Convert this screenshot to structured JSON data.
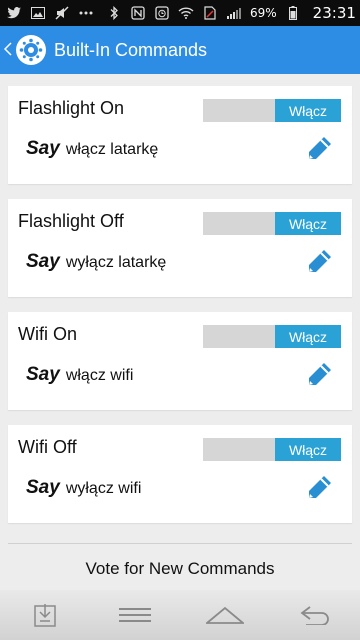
{
  "status_bar": {
    "battery": "69%",
    "clock": "23:31"
  },
  "app_bar": {
    "title": "Built-In Commands"
  },
  "commands": [
    {
      "title": "Flashlight On",
      "toggle_label": "Włącz",
      "say_word": "Say",
      "phrase": "włącz latarkę"
    },
    {
      "title": "Flashlight Off",
      "toggle_label": "Włącz",
      "say_word": "Say",
      "phrase": "wyłącz latarkę"
    },
    {
      "title": "Wifi On",
      "toggle_label": "Włącz",
      "say_word": "Say",
      "phrase": "włącz wifi"
    },
    {
      "title": "Wifi Off",
      "toggle_label": "Włącz",
      "say_word": "Say",
      "phrase": "wyłącz wifi"
    }
  ],
  "footer": {
    "vote_label": "Vote for New Commands"
  },
  "colors": {
    "app_bar": "#2d8de5",
    "toggle_on": "#2aa2d6",
    "edit_icon": "#2a8fd2"
  },
  "icons": {
    "status_left": [
      "twitter-icon",
      "image-icon",
      "muted-mic-icon",
      "dots-icon"
    ],
    "status_right": [
      "bluetooth-icon",
      "nfc-icon",
      "alarm-icon",
      "wifi-icon",
      "sim-icon",
      "signal-icon"
    ],
    "nav": [
      "download-icon",
      "menu-icon",
      "home-icon",
      "back-icon"
    ]
  }
}
